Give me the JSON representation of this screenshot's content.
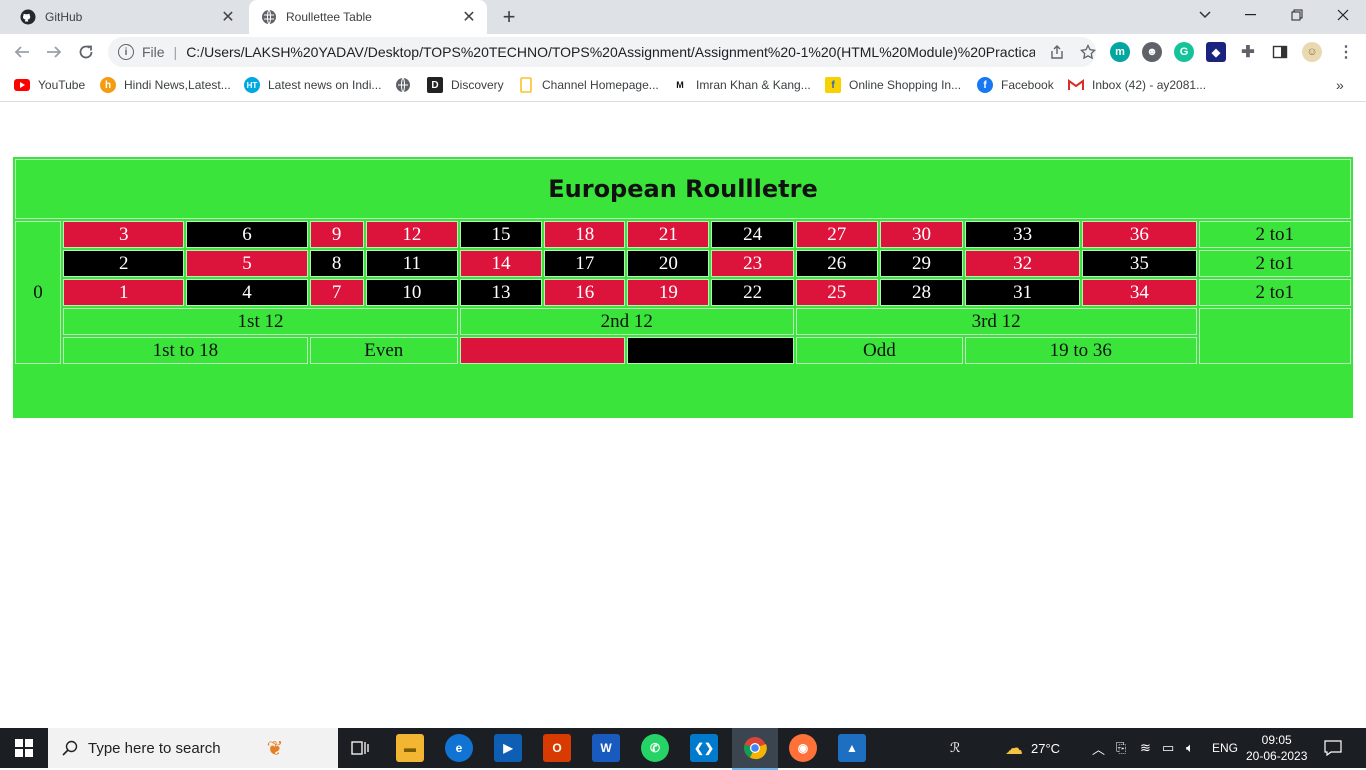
{
  "browser": {
    "tabs": [
      {
        "title": "GitHub",
        "icon": "github-icon"
      },
      {
        "title": "Roullettee Table",
        "icon": "globe-icon"
      }
    ],
    "address": {
      "scheme_label": "File",
      "url": "C:/Users/LAKSH%20YADAV/Desktop/TOPS%20TECHNO/TOPS%20Assignment/Assignment%20-1%20(HTML%20Module)%20Practical/R..."
    },
    "bookmarks": [
      {
        "label": "YouTube",
        "icon": "youtube-icon",
        "color": "#ff0000"
      },
      {
        "label": "Hindi News,Latest...",
        "icon": "news-icon",
        "color": "#f39c12"
      },
      {
        "label": "Latest news on Indi...",
        "icon": "ht-icon",
        "color": "#00a8e1"
      },
      {
        "label": "",
        "icon": "globe-icon",
        "color": "#5f6368"
      },
      {
        "label": "Discovery",
        "icon": "discovery-icon",
        "color": "#222222"
      },
      {
        "label": "Channel Homepage...",
        "icon": "bookmark-icon",
        "color": "#fbc02d"
      },
      {
        "label": "Imran Khan & Kang...",
        "icon": "mtv-icon",
        "color": "#111111"
      },
      {
        "label": "Online Shopping In...",
        "icon": "flipkart-icon",
        "color": "#f7d100"
      },
      {
        "label": "Facebook",
        "icon": "facebook-icon",
        "color": "#1877f2"
      },
      {
        "label": "Inbox (42) - ay2081...",
        "icon": "gmail-icon",
        "color": "#d93025"
      }
    ]
  },
  "roulette": {
    "title": "European Roullletre",
    "zero": "0",
    "rows": [
      [
        {
          "n": "3",
          "c": "red"
        },
        {
          "n": "6",
          "c": "black"
        },
        {
          "n": "9",
          "c": "red"
        },
        {
          "n": "12",
          "c": "red"
        },
        {
          "n": "15",
          "c": "black"
        },
        {
          "n": "18",
          "c": "red"
        },
        {
          "n": "21",
          "c": "red"
        },
        {
          "n": "24",
          "c": "black"
        },
        {
          "n": "27",
          "c": "red"
        },
        {
          "n": "30",
          "c": "red"
        },
        {
          "n": "33",
          "c": "black"
        },
        {
          "n": "36",
          "c": "red"
        }
      ],
      [
        {
          "n": "2",
          "c": "black"
        },
        {
          "n": "5",
          "c": "red"
        },
        {
          "n": "8",
          "c": "black"
        },
        {
          "n": "11",
          "c": "black"
        },
        {
          "n": "14",
          "c": "red"
        },
        {
          "n": "17",
          "c": "black"
        },
        {
          "n": "20",
          "c": "black"
        },
        {
          "n": "23",
          "c": "red"
        },
        {
          "n": "26",
          "c": "black"
        },
        {
          "n": "29",
          "c": "black"
        },
        {
          "n": "32",
          "c": "red"
        },
        {
          "n": "35",
          "c": "black"
        }
      ],
      [
        {
          "n": "1",
          "c": "red"
        },
        {
          "n": "4",
          "c": "black"
        },
        {
          "n": "7",
          "c": "red"
        },
        {
          "n": "10",
          "c": "black"
        },
        {
          "n": "13",
          "c": "black"
        },
        {
          "n": "16",
          "c": "red"
        },
        {
          "n": "19",
          "c": "red"
        },
        {
          "n": "22",
          "c": "black"
        },
        {
          "n": "25",
          "c": "red"
        },
        {
          "n": "28",
          "c": "black"
        },
        {
          "n": "31",
          "c": "black"
        },
        {
          "n": "34",
          "c": "red"
        }
      ]
    ],
    "column_bets": [
      "2 to1",
      "2 to1",
      "2 to1"
    ],
    "dozens": [
      "1st 12",
      "2nd 12",
      "3rd 12"
    ],
    "outside": {
      "low": "1st to 18",
      "even": "Even",
      "odd": "Odd",
      "high": "19 to 36"
    },
    "colors": {
      "red": "#dc143c",
      "black": "#000000",
      "felt": "#3ae43a"
    }
  },
  "taskbar": {
    "search_placeholder": "Type here to search",
    "weather": "27°C",
    "language": "ENG",
    "time": "09:05",
    "date": "20-06-2023"
  }
}
